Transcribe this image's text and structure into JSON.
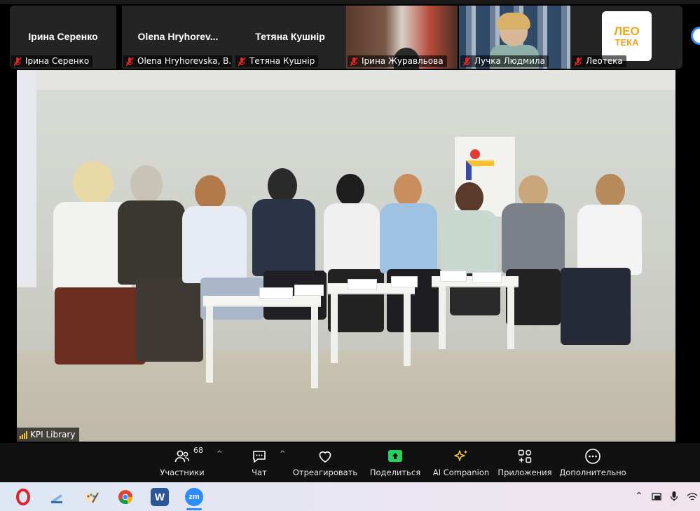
{
  "participants": [
    {
      "title": "Ірина Серенко",
      "label": "Ірина Серенко",
      "muted": true
    },
    {
      "title": "Olena  Hryhorev...",
      "label": "Olena Hryhorevska, B...",
      "muted": true
    },
    {
      "title": "Тетяна Кушнір",
      "label": "Тетяна Кушнір",
      "muted": true
    },
    {
      "title": "",
      "label": "Ірина Журавльова",
      "muted": true
    },
    {
      "title": "",
      "label": "Лучка Людмила",
      "muted": true
    },
    {
      "title": "",
      "label": "Леотека",
      "muted": true
    }
  ],
  "logo": {
    "line1": "ЛЕО",
    "line2": "ТЕКА"
  },
  "main_video": {
    "label": "KPI Library"
  },
  "toolbar": {
    "participants_label": "Участники",
    "participants_count": "68",
    "chat_label": "Чат",
    "react_label": "Отреагировать",
    "share_label": "Поделиться",
    "ai_label": "AI Companion",
    "apps_label": "Приложения",
    "more_label": "Дополнительно"
  },
  "taskbar": {
    "zoom_app": "zm"
  },
  "colors": {
    "share_green": "#23d160",
    "accent_blue": "#2d8cff",
    "mute_red": "#e02828"
  }
}
